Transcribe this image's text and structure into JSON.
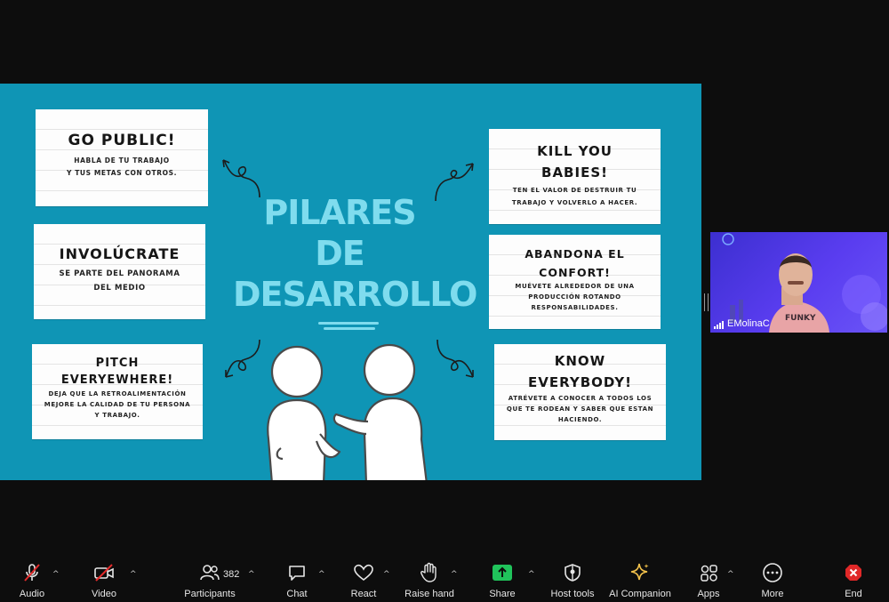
{
  "slide": {
    "title_lines": [
      "PILARES",
      "DE",
      "DESARROLLO"
    ],
    "cards": {
      "go_public": {
        "title": "GO PUBLIC!",
        "text1": "HABLA DE TU TRABAJO",
        "text2": "Y TUS METAS CON OTROS."
      },
      "involucrate": {
        "title": "INVOLÚCRATE",
        "text1": "SE PARTE DEL PANORAMA",
        "text2": "DEL MEDIO"
      },
      "pitch": {
        "title1": "PITCH",
        "title2": "EVERYEWHERE!",
        "text1": "DEJA QUE LA RETROALIMENTACIÓN",
        "text2": "MEJORE LA CALIDAD DE TU PERSONA",
        "text3": "Y TRABAJO."
      },
      "kill": {
        "title1": "KILL YOU",
        "title2": "BABIES!",
        "text1": "TEN EL VALOR DE DESTRUIR TU",
        "text2": "TRABAJO Y VOLVERLO A HACER."
      },
      "abandona": {
        "title1": "ABANDONA EL",
        "title2": "CONFORT!",
        "text1": "MUÉVETE ALREDEDOR DE UNA",
        "text2": "PRODUCCIÓN ROTANDO",
        "text3": "RESPONSABILIDADES."
      },
      "know": {
        "title1": "KNOW",
        "title2": "EVERYBODY!",
        "text1": "ATRÉVETE A CONOCER A TODOS LOS",
        "text2": "QUE TE RODEAN Y SABER QUE ESTAN",
        "text3": "HACIENDO."
      }
    }
  },
  "video": {
    "participant_name": "EMolinaC",
    "shirt_text": "FUNKY"
  },
  "toolbar": {
    "audio": "Audio",
    "video": "Video",
    "participants": "Participants",
    "participants_count": "382",
    "chat": "Chat",
    "react": "React",
    "raise_hand": "Raise hand",
    "share": "Share",
    "host_tools": "Host tools",
    "ai_companion": "AI Companion",
    "apps": "Apps",
    "more": "More",
    "end": "End"
  },
  "colors": {
    "slide_bg": "#0f95b5",
    "title": "#7fdcee",
    "share": "#20c35b",
    "end": "#e02828"
  },
  "icons": [
    "mic-muted-icon",
    "camera-off-icon",
    "participants-icon",
    "chat-icon",
    "heart-icon",
    "hand-icon",
    "share-arrow-icon",
    "shield-icon",
    "sparkle-icon",
    "apps-icon",
    "more-icon",
    "end-x-icon"
  ]
}
